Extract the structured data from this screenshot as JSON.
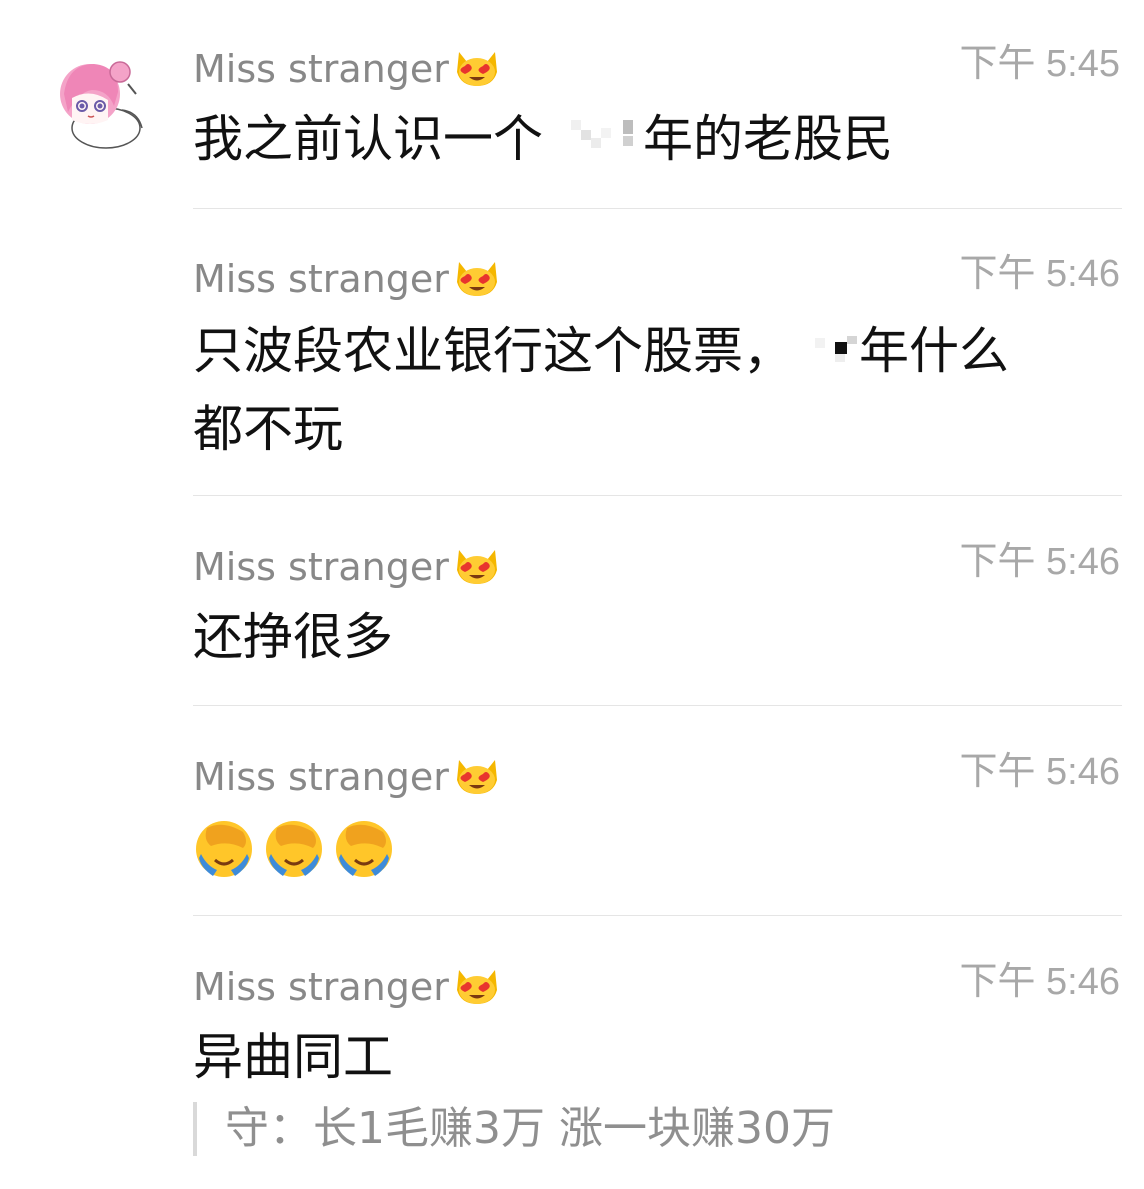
{
  "chat": {
    "avatar_icon": "anime-girl-avatar-icon",
    "messages": [
      {
        "sender": "Miss stranger",
        "sender_emoji": "heart-eyes-cat-icon",
        "time": "下午 5:45",
        "text_parts": [
          "我之前认识一个",
          "年的老股民"
        ]
      },
      {
        "sender": "Miss stranger",
        "sender_emoji": "heart-eyes-cat-icon",
        "time": "下午 5:46",
        "text_parts": [
          "只波段农业银行这个股票，",
          "年什么",
          "都不玩"
        ]
      },
      {
        "sender": "Miss stranger",
        "sender_emoji": "heart-eyes-cat-icon",
        "time": "下午 5:46",
        "text": "还挣很多"
      },
      {
        "sender": "Miss stranger",
        "sender_emoji": "heart-eyes-cat-icon",
        "time": "下午 5:46",
        "emojis": [
          "facepalm-crying-icon",
          "facepalm-crying-icon",
          "facepalm-crying-icon"
        ]
      },
      {
        "sender": "Miss stranger",
        "sender_emoji": "heart-eyes-cat-icon",
        "time": "下午 5:46",
        "text": "异曲同工",
        "quote": "守：长1毛赚3万   涨一块赚30万"
      }
    ]
  }
}
